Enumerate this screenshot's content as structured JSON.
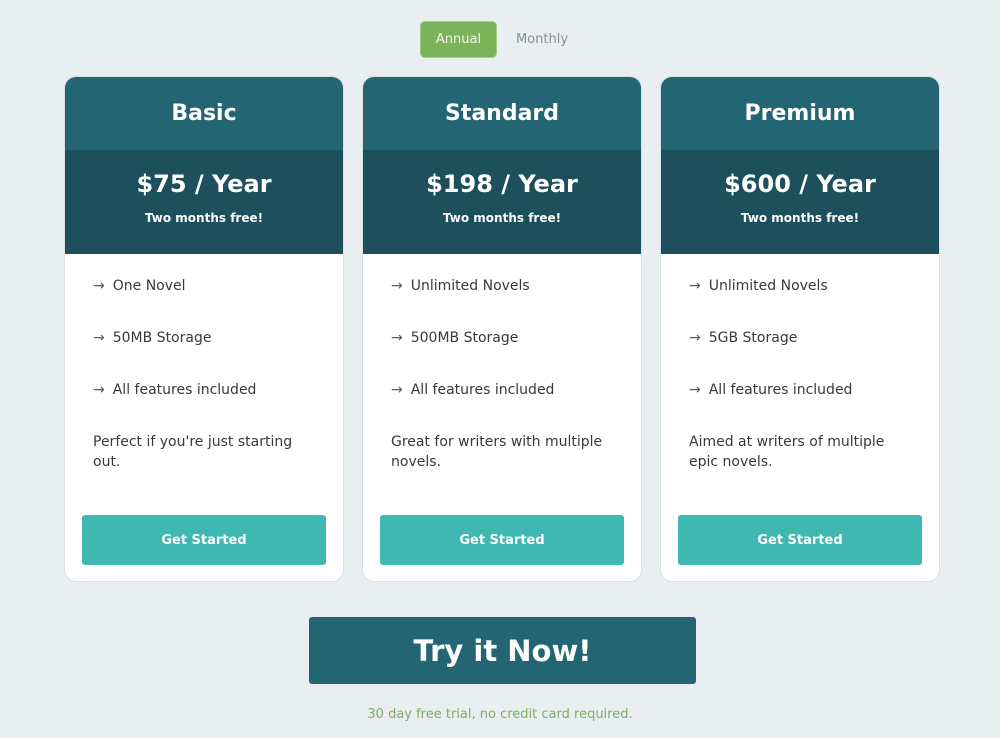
{
  "billing_toggle": {
    "options": [
      {
        "label": "Annual",
        "active": true
      },
      {
        "label": "Monthly",
        "active": false
      }
    ]
  },
  "colors": {
    "page_bg": "#e9eef1",
    "header_teal": "#236572",
    "price_teal": "#1d4f5c",
    "cta_teal": "#3fb8b1",
    "toggle_green": "#7bb25a",
    "note_green": "#7fad61"
  },
  "plans": [
    {
      "name": "Basic",
      "price": "$75 / Year",
      "price_note": "Two months free!",
      "features": [
        {
          "icon": "arrow-right-icon",
          "glyph": "→",
          "text": "One Novel"
        },
        {
          "icon": "arrow-right-icon",
          "glyph": "→",
          "text": "50MB Storage"
        },
        {
          "icon": "arrow-right-icon",
          "glyph": "→",
          "text": "All features included"
        }
      ],
      "description": "Perfect if you're just starting out.",
      "cta_label": "Get Started"
    },
    {
      "name": "Standard",
      "price": "$198 / Year",
      "price_note": "Two months free!",
      "features": [
        {
          "icon": "arrow-right-icon",
          "glyph": "→",
          "text": "Unlimited Novels"
        },
        {
          "icon": "arrow-right-icon",
          "glyph": "→",
          "text": "500MB Storage"
        },
        {
          "icon": "arrow-right-icon",
          "glyph": "→",
          "text": "All features included"
        }
      ],
      "description": "Great for writers with multiple novels.",
      "cta_label": "Get Started"
    },
    {
      "name": "Premium",
      "price": "$600 / Year",
      "price_note": "Two months free!",
      "features": [
        {
          "icon": "arrow-right-icon",
          "glyph": "→",
          "text": "Unlimited Novels"
        },
        {
          "icon": "arrow-right-icon",
          "glyph": "→",
          "text": "5GB Storage"
        },
        {
          "icon": "arrow-right-icon",
          "glyph": "→",
          "text": "All features included"
        }
      ],
      "description": "Aimed at writers of multiple epic novels.",
      "cta_label": "Get Started"
    }
  ],
  "try_now": {
    "label": "Try it Now!",
    "note": "30 day free trial, no credit card required."
  }
}
